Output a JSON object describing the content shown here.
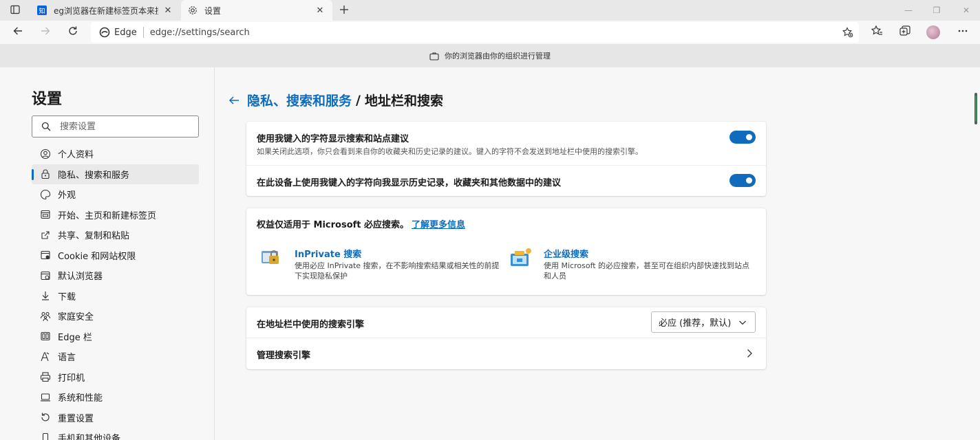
{
  "tabs": [
    {
      "title": "eg浏览器在新建标签页本来搜索",
      "favicon": "知",
      "close": "✕"
    },
    {
      "title": "设置",
      "close": "✕"
    }
  ],
  "window_controls": {
    "minimize": "—",
    "restore": "❐",
    "close": "✕"
  },
  "addressbar": {
    "label": "Edge",
    "url": "edge://settings/search"
  },
  "managed_banner": "你的浏览器由你的组织进行管理",
  "sidebar": {
    "title": "设置",
    "search_placeholder": "搜索设置",
    "items": [
      {
        "label": "个人资料",
        "icon": "profile-icon"
      },
      {
        "label": "隐私、搜索和服务",
        "icon": "lock-icon",
        "active": true
      },
      {
        "label": "外观",
        "icon": "appearance-icon"
      },
      {
        "label": "开始、主页和新建标签页",
        "icon": "home-icon"
      },
      {
        "label": "共享、复制和粘贴",
        "icon": "share-icon"
      },
      {
        "label": "Cookie 和网站权限",
        "icon": "site-permissions-icon"
      },
      {
        "label": "默认浏览器",
        "icon": "browser-icon"
      },
      {
        "label": "下载",
        "icon": "download-icon"
      },
      {
        "label": "家庭安全",
        "icon": "family-icon"
      },
      {
        "label": "Edge 栏",
        "icon": "edge-bar-icon"
      },
      {
        "label": "语言",
        "icon": "language-icon"
      },
      {
        "label": "打印机",
        "icon": "printer-icon"
      },
      {
        "label": "系统和性能",
        "icon": "system-icon"
      },
      {
        "label": "重置设置",
        "icon": "reset-icon"
      },
      {
        "label": "手机和其他设备",
        "icon": "phone-icon"
      }
    ]
  },
  "breadcrumb": {
    "parent": "隐私、搜索和服务",
    "separator": "/",
    "current": "地址栏和搜索"
  },
  "card1": {
    "row1_title": "使用我键入的字符显示搜索和站点建议",
    "row1_desc": "如果关闭此选项，你只会看到来自你的收藏夹和历史记录的建议。键入的字符不会发送到地址栏中使用的搜索引擎。",
    "row1_toggle": true,
    "row2_title": "在此设备上使用我键入的字符向我显示历史记录，收藏夹和其他数据中的建议",
    "row2_toggle": true
  },
  "card2": {
    "title": "权益仅适用于 Microsoft 必应搜索。",
    "link": "了解更多信息",
    "features": [
      {
        "title": "InPrivate 搜索",
        "desc": "使用必应 InPrivate 搜索，在不影响搜索结果或相关性的前提下实现隐私保护"
      },
      {
        "title": "企业级搜索",
        "desc": "使用 Microsoft 的必应搜索，甚至可在组织内部快速找到站点和人员"
      }
    ]
  },
  "card3": {
    "engine_label": "在地址栏中使用的搜索引擎",
    "engine_value": "必应 (推荐，默认)",
    "manage_label": "管理搜索引擎"
  },
  "colors": {
    "accent": "#0f6cbd",
    "scroll_accent": "#2e9e5a"
  }
}
